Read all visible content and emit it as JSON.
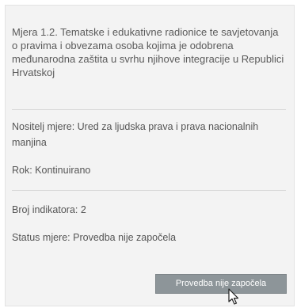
{
  "card": {
    "title": "Mjera 1.2. Tematske i edukativne radionice te savjetovanja o pravima i obvezama osoba kojima je odobrena međunarodna zaštita u svrhu njihove integracije u Republici Hrvatskoj",
    "holder": "Nositelj mjere: Ured za ljudska prava i prava nacionalnih manjina",
    "deadline": "Rok: Kontinuirano",
    "indicator_count": "Broj indikatora: 2",
    "status": "Status mjere: Provedba nije započela",
    "status_button_label": "Provedba nije započela"
  },
  "colors": {
    "card_background": "#f3f3f3",
    "button_background": "#8d9599",
    "text": "#555555"
  },
  "icons": {
    "cursor": "mouse-pointer-icon"
  }
}
